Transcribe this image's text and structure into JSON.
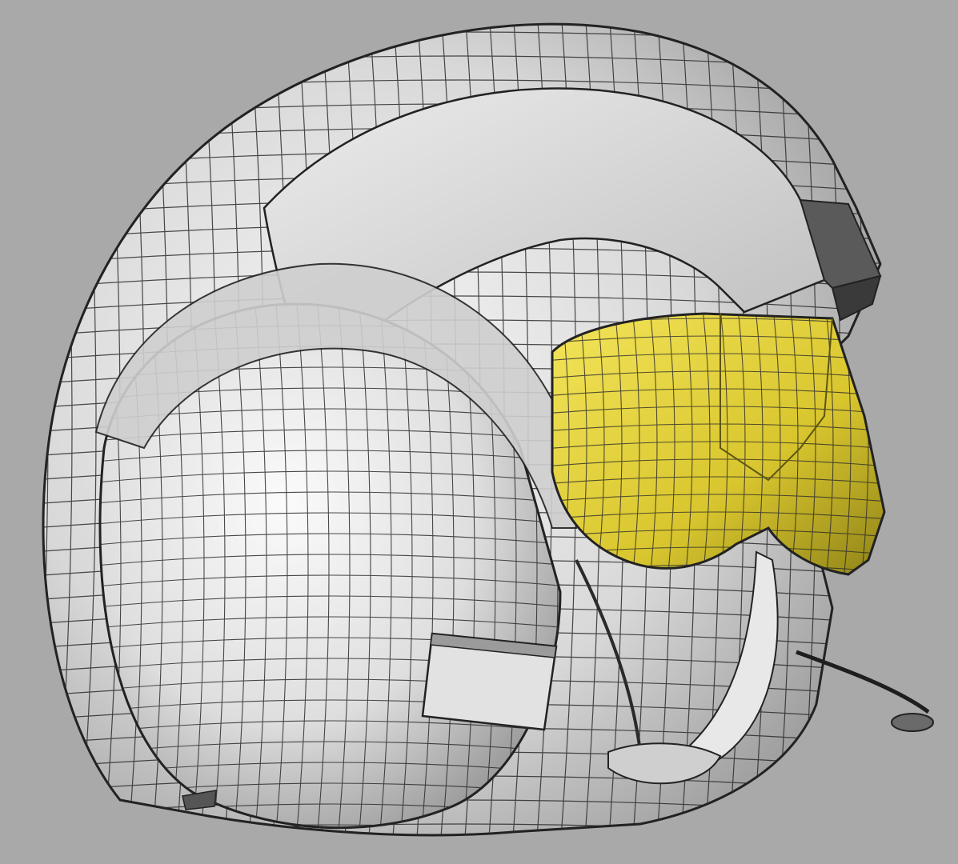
{
  "scene": {
    "subject": "helmet-wireframe-model",
    "background_color": "#a9a9a9",
    "shell_color": "#dcdcdc",
    "visor_color": "#e6d63a",
    "wire_color": "#2b2b2b",
    "shadow_color": "#4a4a4a"
  }
}
